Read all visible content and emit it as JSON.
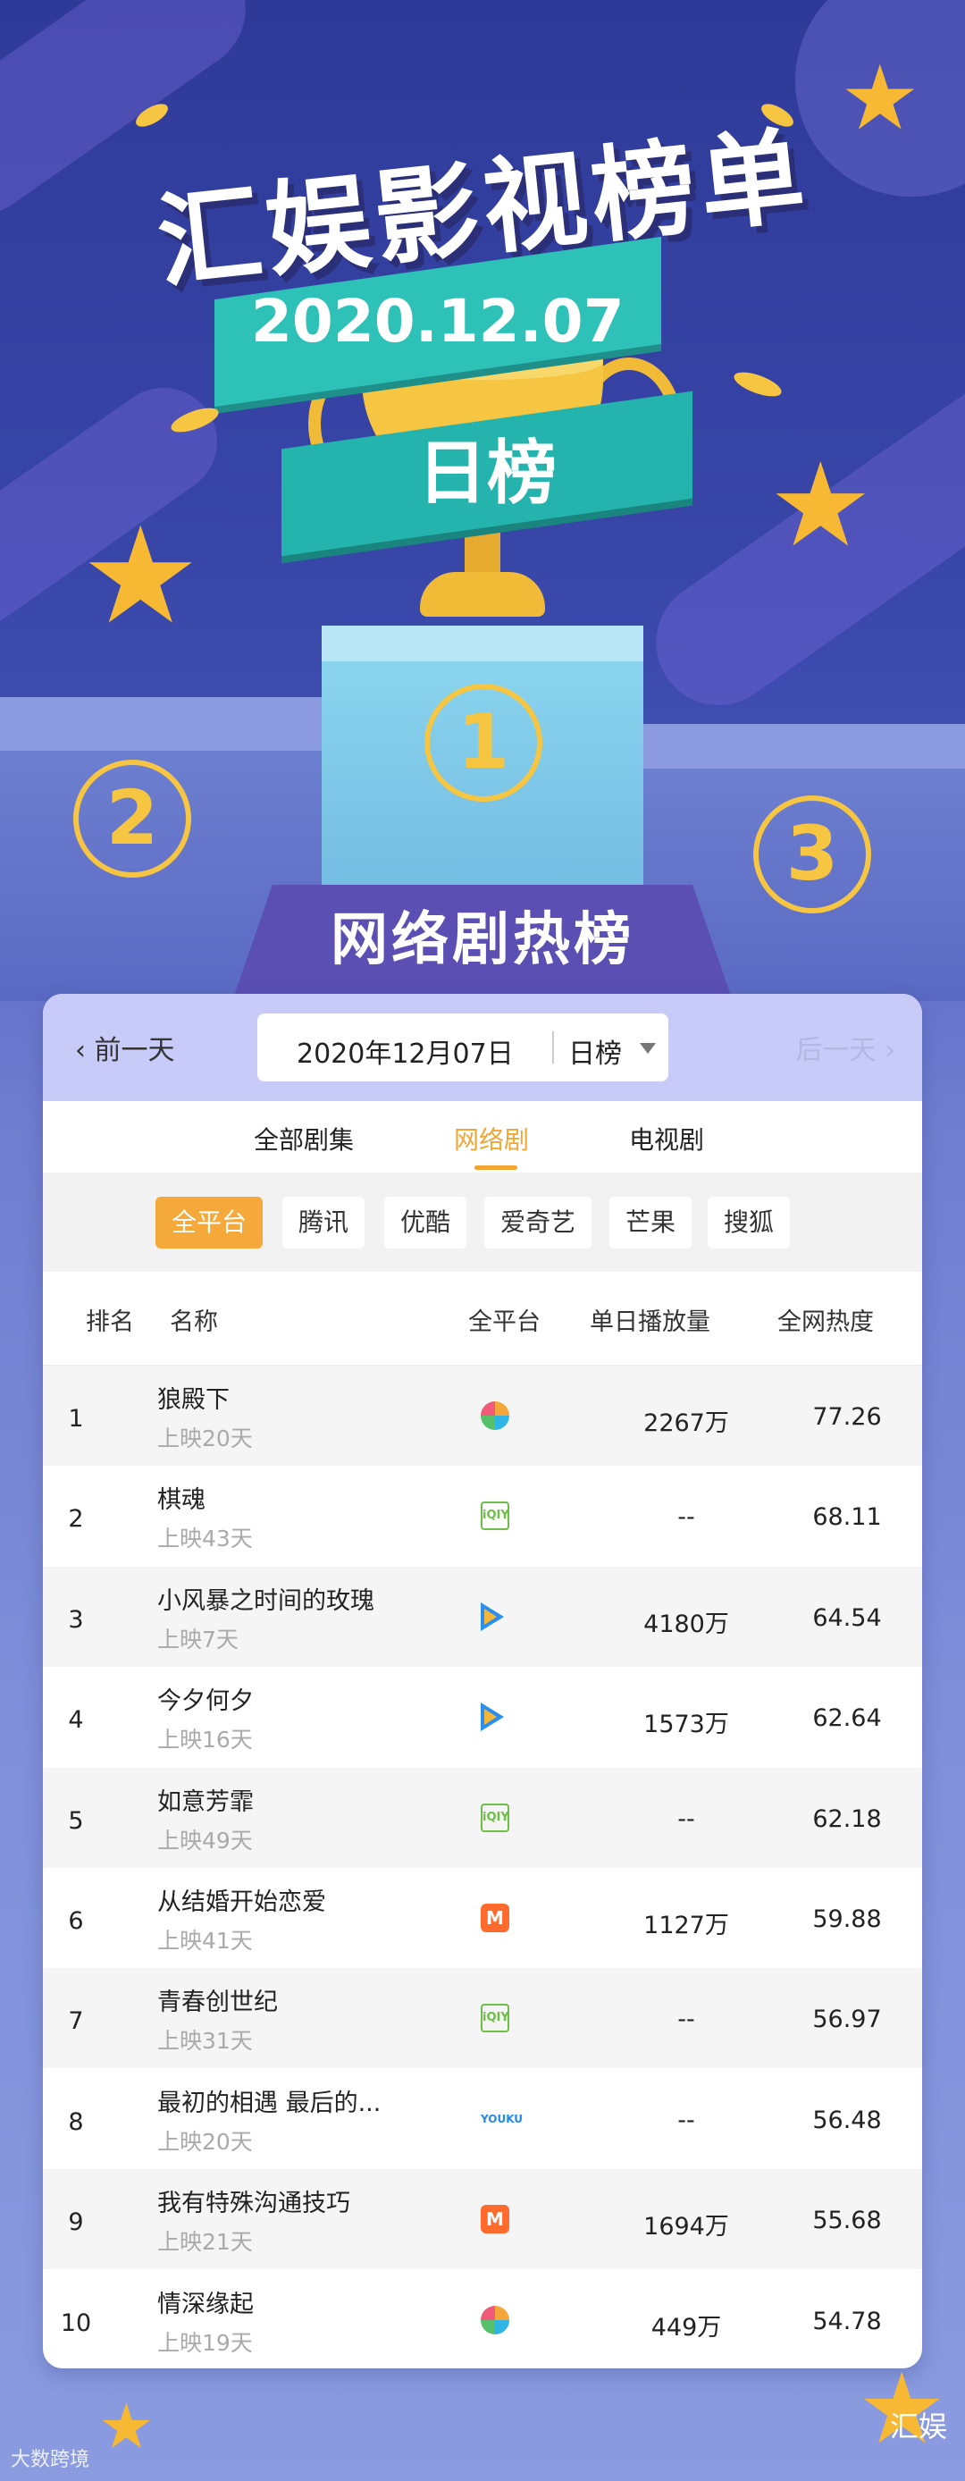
{
  "header": {
    "title": "汇娱影视榜单",
    "date": "2020.12.07",
    "board": "日榜",
    "medals": [
      "2",
      "1",
      "3"
    ],
    "section_title": "网络剧热榜"
  },
  "datebar": {
    "prev_label": "前一天",
    "next_label": "后一天",
    "date_value": "2020年12月07日",
    "type_value": "日榜"
  },
  "tabs": [
    "全部剧集",
    "网络剧",
    "电视剧"
  ],
  "active_tab": "网络剧",
  "platforms": [
    "全平台",
    "腾讯",
    "优酷",
    "爱奇艺",
    "芒果",
    "搜狐"
  ],
  "columns": {
    "rank": "排名",
    "name": "名称",
    "platform": "全平台",
    "plays": "单日播放量",
    "heat": "全网热度"
  },
  "rows": [
    {
      "rank": "1",
      "name": "狼殿下",
      "days": "上映20天",
      "platform_icon": "multi-platform-icon",
      "plays": "2267万",
      "heat": "77.26"
    },
    {
      "rank": "2",
      "name": "棋魂",
      "days": "上映43天",
      "platform_icon": "iqiyi-icon",
      "plays": "--",
      "heat": "68.11"
    },
    {
      "rank": "3",
      "name": "小风暴之时间的玫瑰",
      "days": "上映7天",
      "platform_icon": "tencent-video-icon",
      "plays": "4180万",
      "heat": "64.54"
    },
    {
      "rank": "4",
      "name": "今夕何夕",
      "days": "上映16天",
      "platform_icon": "tencent-video-icon",
      "plays": "1573万",
      "heat": "62.64"
    },
    {
      "rank": "5",
      "name": "如意芳霏",
      "days": "上映49天",
      "platform_icon": "iqiyi-icon",
      "plays": "--",
      "heat": "62.18"
    },
    {
      "rank": "6",
      "name": "从结婚开始恋爱",
      "days": "上映41天",
      "platform_icon": "mango-tv-icon",
      "plays": "1127万",
      "heat": "59.88"
    },
    {
      "rank": "7",
      "name": "青春创世纪",
      "days": "上映31天",
      "platform_icon": "iqiyi-icon",
      "plays": "--",
      "heat": "56.97"
    },
    {
      "rank": "8",
      "name": "最初的相遇 最后的...",
      "days": "上映20天",
      "platform_icon": "youku-icon",
      "plays": "--",
      "heat": "56.48"
    },
    {
      "rank": "9",
      "name": "我有特殊沟通技巧",
      "days": "上映21天",
      "platform_icon": "mango-tv-icon",
      "plays": "1694万",
      "heat": "55.68"
    },
    {
      "rank": "10",
      "name": "情深缘起",
      "days": "上映19天",
      "platform_icon": "multi-platform-icon",
      "plays": "449万",
      "heat": "54.78"
    }
  ],
  "footer": {
    "watermark": "大数跨境",
    "account": "汇娱"
  },
  "colors": {
    "accent": "#f2a531",
    "datebar": "#c8cbf7",
    "background": "#3d4aa8"
  }
}
